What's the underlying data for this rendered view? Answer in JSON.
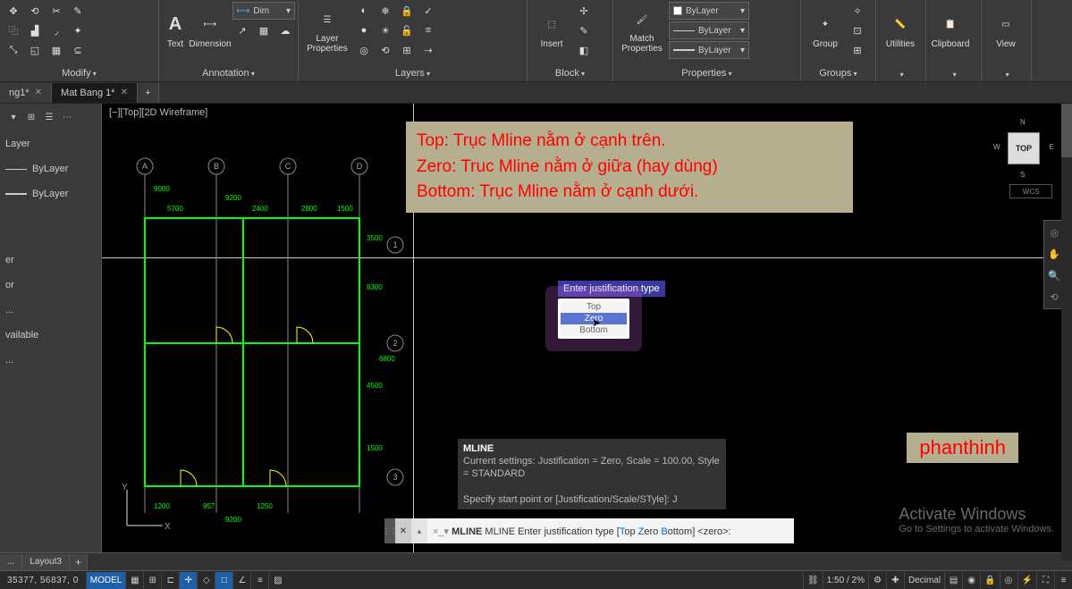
{
  "ribbon": {
    "panels": {
      "modify": "Modify",
      "annotation": "Annotation",
      "layers": "Layers",
      "block": "Block",
      "properties": "Properties",
      "groups": "Groups",
      "utilities": "Utilities",
      "clipboard": "Clipboard",
      "view": "View"
    },
    "text_btn": "Text",
    "dimension_btn": "Dimension",
    "dim_style": "Dim",
    "layer_props_btn": "Layer\nProperties",
    "insert_btn": "Insert",
    "match_btn": "Match\nProperties",
    "group_btn": "Group",
    "prop_color": "ByLayer",
    "prop_line": "ByLayer",
    "prop_weight": "ByLayer"
  },
  "doc_tabs": {
    "t1": "ng1*",
    "t2": "Mat Bang 1*",
    "add": "+"
  },
  "viewport_label": "[−][Top][2D Wireframe]",
  "viewcube": {
    "face": "TOP",
    "n": "N",
    "s": "S",
    "e": "E",
    "w": "W",
    "wcs": "WCS"
  },
  "left": {
    "line1": "Layer",
    "line2": "ByLayer",
    "line3": "ByLayer",
    "line4": "er",
    "line5": "or",
    "line6": "...",
    "line7": "vailable",
    "line8": "..."
  },
  "drawing": {
    "dims_top": [
      "9000",
      "9200",
      "5700",
      "2400",
      "2800",
      "1500"
    ],
    "dims_bot": [
      "1200",
      "957",
      "1250",
      "9200"
    ],
    "dims_right": [
      "3500",
      "8300",
      "4500",
      "1500",
      "6800"
    ],
    "bubbles_top": [
      "A",
      "B",
      "C",
      "D"
    ],
    "bubbles_right": [
      "1",
      "2",
      "3"
    ]
  },
  "overlay": {
    "l1": "Top: Trục Mline nằm ở cạnh trên.",
    "l2": "Zero: Truc Mline nằm ở giữa (hay dùng)",
    "l3": "Bottom: Trục Mline nằm ở cạnh dưới."
  },
  "watermark": "phanthinh",
  "dynamic": {
    "tip": "Enter justification type",
    "opt1": "Top",
    "opt2": "Zero",
    "opt3": "Bottom"
  },
  "cmd": {
    "name": "MLINE",
    "hist1": "Current settings: Justification = Zero, Scale = 100.00, Style = STANDARD",
    "hist2": "Specify start point or [Justification/Scale/STyle]:  J",
    "line_pre": "MLINE Enter justification type [",
    "kw1": "T",
    "kw1r": "op ",
    "kw2": "Z",
    "kw2r": "ero ",
    "kw3": "B",
    "kw3r": "ottom",
    "line_post": "] <zero>:"
  },
  "actwin": {
    "t1": "Activate Windows",
    "t2": "Go to Settings to activate Windows."
  },
  "layout_tabs": {
    "t1": "...",
    "t2": "Layout3",
    "add": "+"
  },
  "status": {
    "coords": "35377, 56837, 0",
    "model": "MODEL",
    "scale": "1:50 / 2%",
    "units": "Decimal"
  }
}
